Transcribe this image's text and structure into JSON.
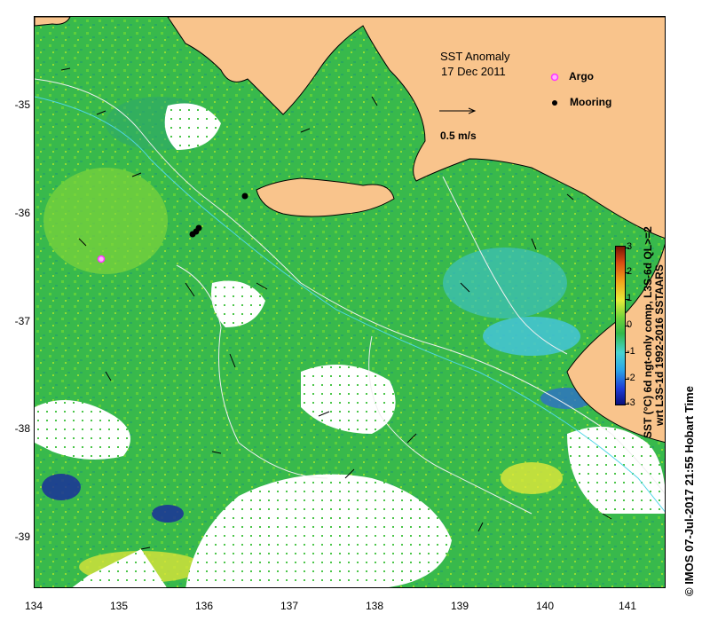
{
  "map": {
    "title": "SST Anomaly",
    "date": "17 Dec 2011",
    "velocity_scale_label": "0.5 m/s",
    "legend": {
      "argo_label": "Argo",
      "mooring_label": "Mooring"
    },
    "lat_ticks": [
      "-35",
      "-36",
      "-37",
      "-38",
      "-39"
    ],
    "lon_ticks": [
      "134",
      "135",
      "136",
      "137",
      "138",
      "139",
      "140",
      "141"
    ],
    "colorbar": {
      "ticks": [
        "3",
        "2",
        "1",
        "0",
        "-1",
        "-2",
        "-3"
      ],
      "label_line1": "SST (°C) 6d ngt-only comp, L3S-6d QL>=2",
      "label_line2": "wrt L3S-1d 1992-2016 SSTAARS"
    },
    "credit": "© IMOS 07-Jul-2017 21:55 Hobart Time",
    "colors": {
      "land": "#f9c48c",
      "sea_green": "#34b84a",
      "anomaly_cyan": "#3fc6d8",
      "cloud_white": "#ffffff",
      "argo_marker": "#ff33ff",
      "mooring_marker": "#000000"
    }
  }
}
